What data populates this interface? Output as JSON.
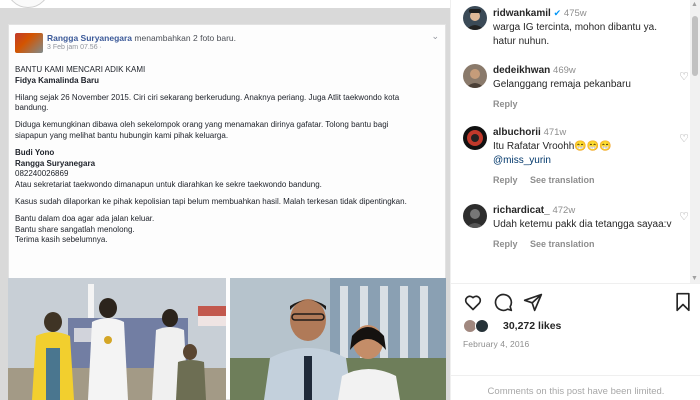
{
  "fb_post": {
    "author": "Rangga Suryanegara",
    "action": "menambahkan 2 foto baru.",
    "time": "3 Feb jam 07.56 ·",
    "lines": [
      {
        "t": "BANTU KAMI MENCARI ADIK KAMI",
        "b": false
      },
      {
        "t": "Fidya Kamalinda Baru",
        "b": true
      },
      {
        "t": "",
        "b": false
      },
      {
        "t": "Hilang sejak 26 November 2015. Ciri ciri sekarang berkerudung. Anaknya periang. Juga Atlit taekwondo kota",
        "b": false
      },
      {
        "t": "bandung.",
        "b": false
      },
      {
        "t": "",
        "b": false
      },
      {
        "t": "Diduga kemungkinan dibawa oleh sekelompok orang yang menamakan dirinya gafatar. Tolong bantu bagi",
        "b": false
      },
      {
        "t": "siapapun yang melihat bantu hubungin kami pihak keluarga.",
        "b": false
      },
      {
        "t": "",
        "b": false
      },
      {
        "t": "Budi Yono",
        "b": true
      },
      {
        "t": "Rangga Suryanegara",
        "b": true
      },
      {
        "t": "082240026869",
        "b": false
      },
      {
        "t": "Atau sekretariat taekwondo dimanapun untuk diarahkan ke sekre taekwondo bandung.",
        "b": false
      },
      {
        "t": "",
        "b": false
      },
      {
        "t": "Kasus sudah dilaporkan ke pihak kepolisian tapi belum membuahkan hasil. Malah terkesan tidak dipentingkan.",
        "b": false
      },
      {
        "t": "",
        "b": false
      },
      {
        "t": "Bantu dalam doa agar ada jalan keluar.",
        "b": false
      },
      {
        "t": "Bantu share sangatlah menolong.",
        "b": false
      },
      {
        "t": "Terima kasih sebelumnya.",
        "b": false
      }
    ]
  },
  "comments": [
    {
      "user": "ridwankamil",
      "time": "475w",
      "text": "warga IG tercinta, mohon dibantu ya. hatur nuhun.",
      "mention": "",
      "reply": "",
      "see": "",
      "heart": false
    },
    {
      "user": "dedeikhwan",
      "time": "469w",
      "text": "Gelanggang remaja pekanbaru",
      "mention": "",
      "reply": "Reply",
      "see": "",
      "heart": true
    },
    {
      "user": "albuchorii",
      "time": "471w",
      "text": "Itu Rafatar Vroohh😁😁😁",
      "mention": "@miss_yurin",
      "reply": "Reply",
      "see": "See translation",
      "heart": true
    },
    {
      "user": "richardicat_",
      "time": "472w",
      "text": "Udah ketemu pakk dia tetangga sayaa:v",
      "mention": "",
      "reply": "Reply",
      "see": "See translation",
      "heart": true
    }
  ],
  "post": {
    "likes": "30,272 likes",
    "date": "February 4, 2016",
    "limited": "Comments on this post have been limited."
  },
  "icons": {
    "like": "heart-icon",
    "comment": "comment-icon",
    "share": "share-icon",
    "save": "bookmark-icon",
    "verified": "verified-badge-icon"
  },
  "colors": {
    "mention": "#00376b",
    "verified": "#0095f6",
    "muted": "#8e8e8e"
  }
}
